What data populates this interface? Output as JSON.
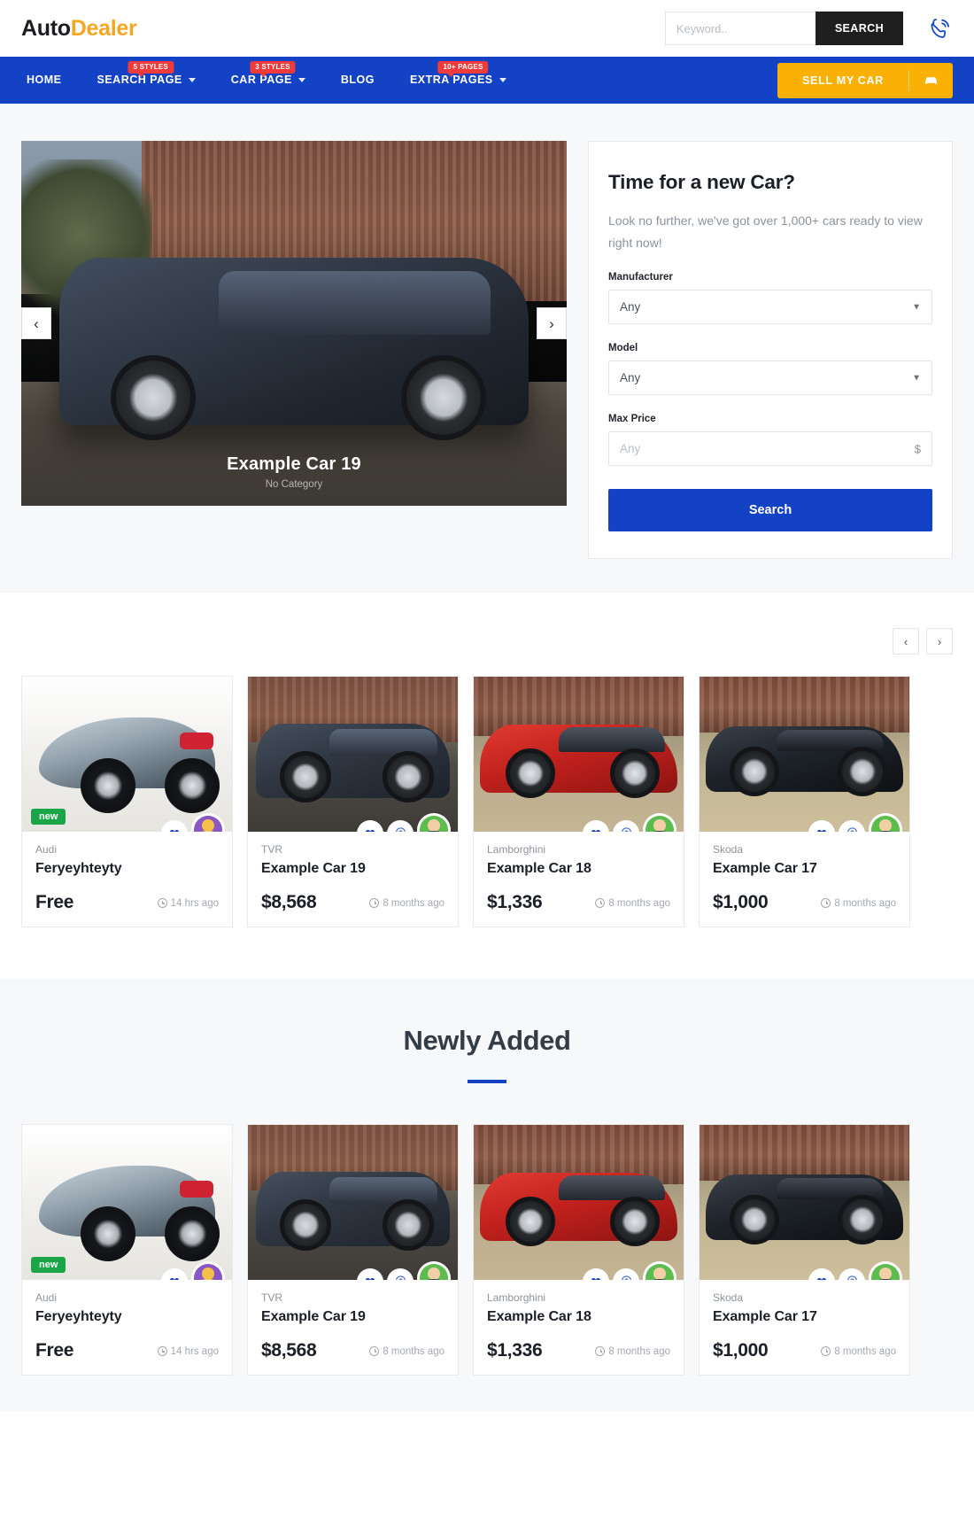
{
  "header": {
    "logo_auto": "Auto",
    "logo_dealer": "Dealer",
    "search_placeholder": "Keyword..",
    "search_value": "",
    "search_button": "SEARCH",
    "phone_icon": "phone-icon"
  },
  "nav": {
    "items": [
      {
        "label": "HOME",
        "badge": "",
        "caret": false
      },
      {
        "label": "SEARCH PAGE",
        "badge": "5 STYLES",
        "caret": true
      },
      {
        "label": "CAR PAGE",
        "badge": "3 STYLES",
        "caret": true
      },
      {
        "label": "BLOG",
        "badge": "",
        "caret": false
      },
      {
        "label": "EXTRA PAGES",
        "badge": "10+ PAGES",
        "caret": true
      }
    ],
    "cta_label": "SELL MY CAR",
    "cta_icon": "car-icon"
  },
  "hero": {
    "title": "Example Car 19",
    "subtitle": "No Category",
    "prev_label": "‹",
    "next_label": "›"
  },
  "panel": {
    "title": "Time for a new Car?",
    "description": "Look no further, we've got over 1,000+ cars ready to view right now!",
    "fields": [
      {
        "label": "Manufacturer",
        "value": "Any",
        "type": "select"
      },
      {
        "label": "Model",
        "value": "Any",
        "type": "select"
      },
      {
        "label": "Max Price",
        "value": "",
        "placeholder": "Any",
        "unit": "$",
        "type": "input"
      }
    ],
    "search_button": "Search"
  },
  "carousel": {
    "prev_label": "‹",
    "next_label": "›"
  },
  "newly": {
    "title": "Newly Added"
  },
  "cards": [
    {
      "brand": "Audi",
      "title": "Feryeyhteyty",
      "price": "Free",
      "time": "14 hrs ago",
      "badge": "new",
      "photo": "ph-audi",
      "avatar": "purple",
      "has_pin": false
    },
    {
      "brand": "TVR",
      "title": "Example Car 19",
      "price": "$8,568",
      "time": "8 months ago",
      "badge": "",
      "photo": "ph-suv",
      "avatar": "green",
      "has_pin": true
    },
    {
      "brand": "Lamborghini",
      "title": "Example Car 18",
      "price": "$1,336",
      "time": "8 months ago",
      "badge": "",
      "photo": "ph-red",
      "avatar": "green",
      "has_pin": true
    },
    {
      "brand": "Skoda",
      "title": "Example Car 17",
      "price": "$1,000",
      "time": "8 months ago",
      "badge": "",
      "photo": "ph-black",
      "avatar": "green",
      "has_pin": true
    }
  ],
  "colors": {
    "nav_blue": "#1442c4",
    "accent_yellow": "#fbb005",
    "badge_red": "#ef3b3b",
    "new_green": "#1aa548"
  }
}
